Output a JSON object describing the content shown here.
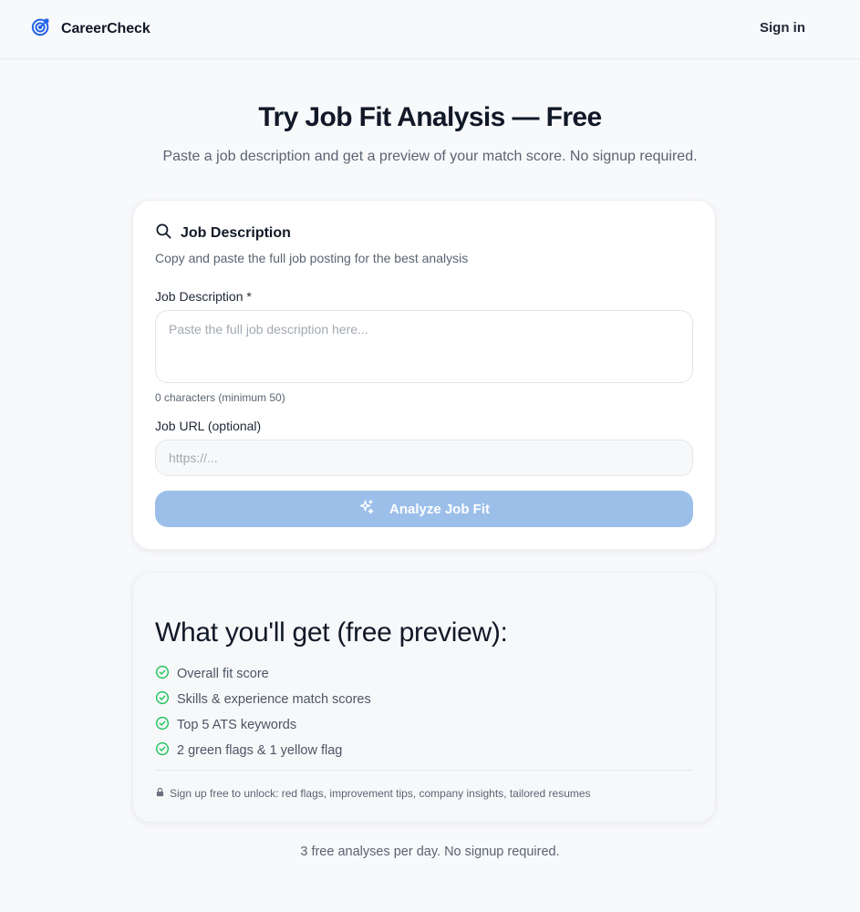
{
  "header": {
    "brand": "CareerCheck",
    "brand_icon": "target-icon",
    "sign_in": "Sign in"
  },
  "hero": {
    "title": "Try Job Fit Analysis — Free",
    "subtitle": "Paste a job description and get a preview of your match score. No signup required."
  },
  "form_card": {
    "icon": "search-icon",
    "title": "Job Description",
    "description": "Copy and paste the full job posting for the best analysis",
    "job_description": {
      "label": "Job Description *",
      "placeholder": "Paste the full job description here...",
      "value": "",
      "char_count": "0 characters (minimum 50)"
    },
    "job_url": {
      "label": "Job URL (optional)",
      "placeholder": "https://...",
      "value": ""
    },
    "analyze_button": {
      "label": "Analyze Job Fit",
      "icon": "sparkles-icon",
      "disabled": true
    }
  },
  "preview_card": {
    "title": "What you'll get (free preview):",
    "features": [
      "Overall fit score",
      "Skills & experience match scores",
      "Top 5 ATS keywords",
      "2 green flags & 1 yellow flag"
    ],
    "feature_icon": "check-circle-icon",
    "unlock_icon": "lock-icon",
    "unlock_text": "Sign up free to unlock: red flags, improvement tips, company insights, tailored resumes"
  },
  "footer": {
    "note": "3 free analyses per day. No signup required."
  },
  "colors": {
    "page_bg": "#f8f9fb",
    "accent": "#2563eb",
    "button_disabled": "#9cbfea",
    "check_green": "#22c55e",
    "text_primary": "#111827",
    "text_muted": "#5b6472"
  }
}
